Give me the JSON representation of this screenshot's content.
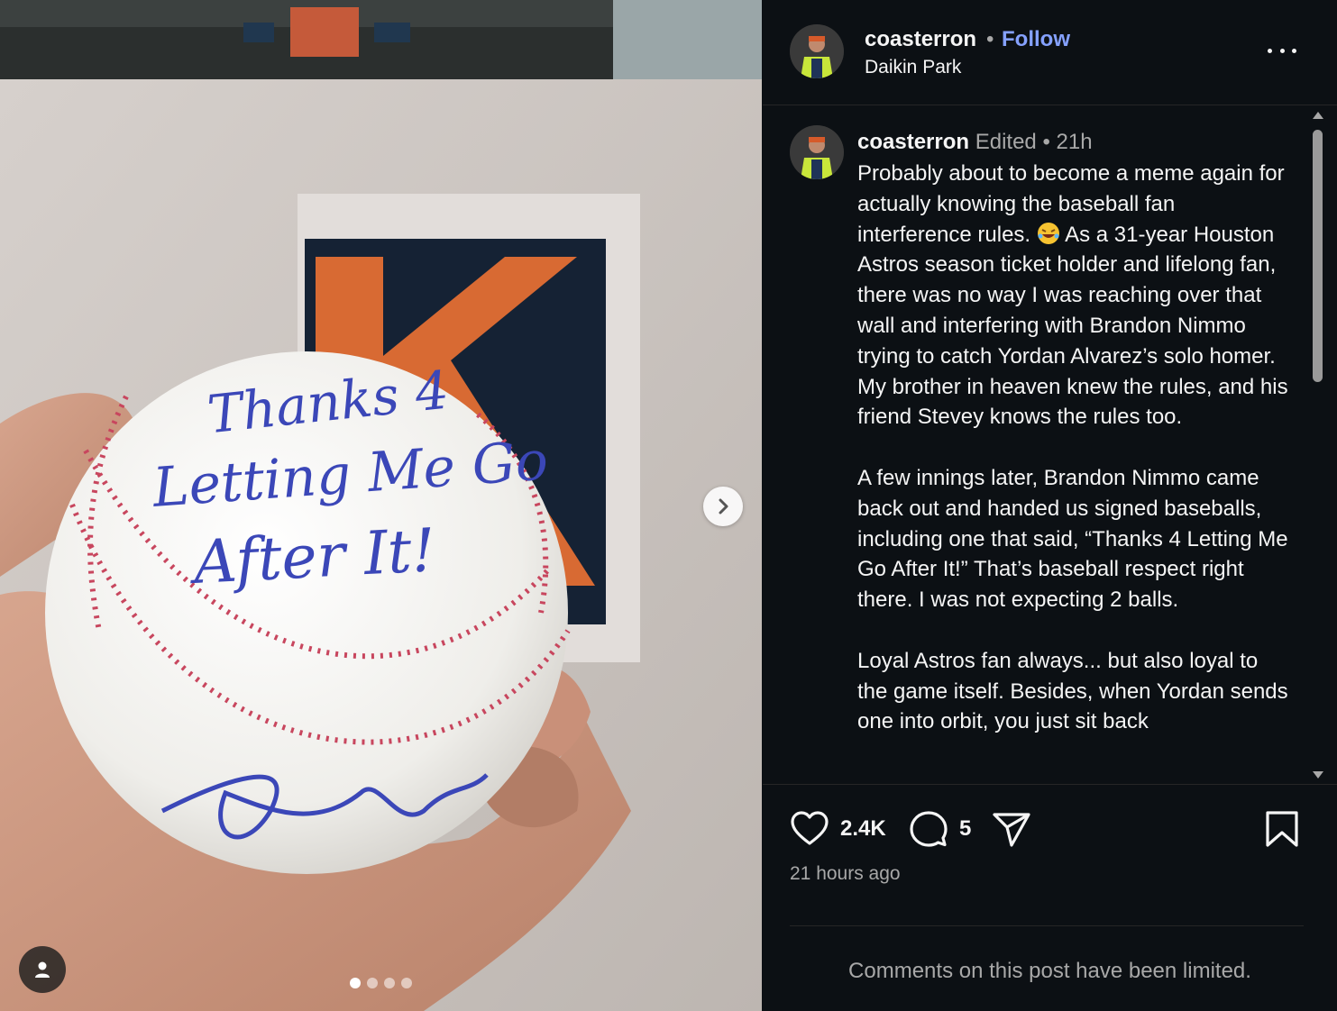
{
  "media": {
    "handwriting_lines": [
      "Thanks 4",
      "Letting Me Go",
      "After It!"
    ],
    "carousel": {
      "total": 4,
      "active": 1
    },
    "next_icon": "chevron-right-icon",
    "tag_icon": "user-icon"
  },
  "header": {
    "username": "coasterron",
    "separator": "•",
    "follow_label": "Follow",
    "location": "Daikin Park",
    "more_icon": "more-horizontal-icon"
  },
  "caption": {
    "username": "coasterron",
    "edited": "Edited",
    "separator": "•",
    "age": "21h",
    "paragraphs": [
      {
        "before": "Probably about to become a meme again for actually knowing the baseball fan interference rules.",
        "emoji": "rolling-on-floor-laughing-emoji",
        "after": "As a 31-year Houston Astros season ticket holder and lifelong fan, there was no way I was reaching over that wall and interfering with Brandon Nimmo trying to catch Yordan Alvarez’s solo homer. My brother in heaven knew the rules, and his friend Stevey knows the rules too."
      },
      {
        "text": "A few innings later, Brandon Nimmo came back out and handed us signed baseballs, including one that said, “Thanks 4 Letting Me Go After It!” That’s baseball respect right there. I was not expecting 2 balls."
      },
      {
        "text": "Loyal Astros fan always... but also loyal to the game itself. Besides, when Yordan sends one into orbit, you just sit back"
      }
    ]
  },
  "actions": {
    "likes": "2.4K",
    "comments": "5",
    "like_icon": "heart-icon",
    "comment_icon": "comment-icon",
    "share_icon": "send-icon",
    "save_icon": "bookmark-icon"
  },
  "timestamp": "21 hours ago",
  "comments_notice": "Comments on this post have been limited.",
  "colors": {
    "background": "#0c1014",
    "follow": "#85a1ff",
    "secondary_text": "#a8a8a8",
    "divider": "#262626"
  }
}
